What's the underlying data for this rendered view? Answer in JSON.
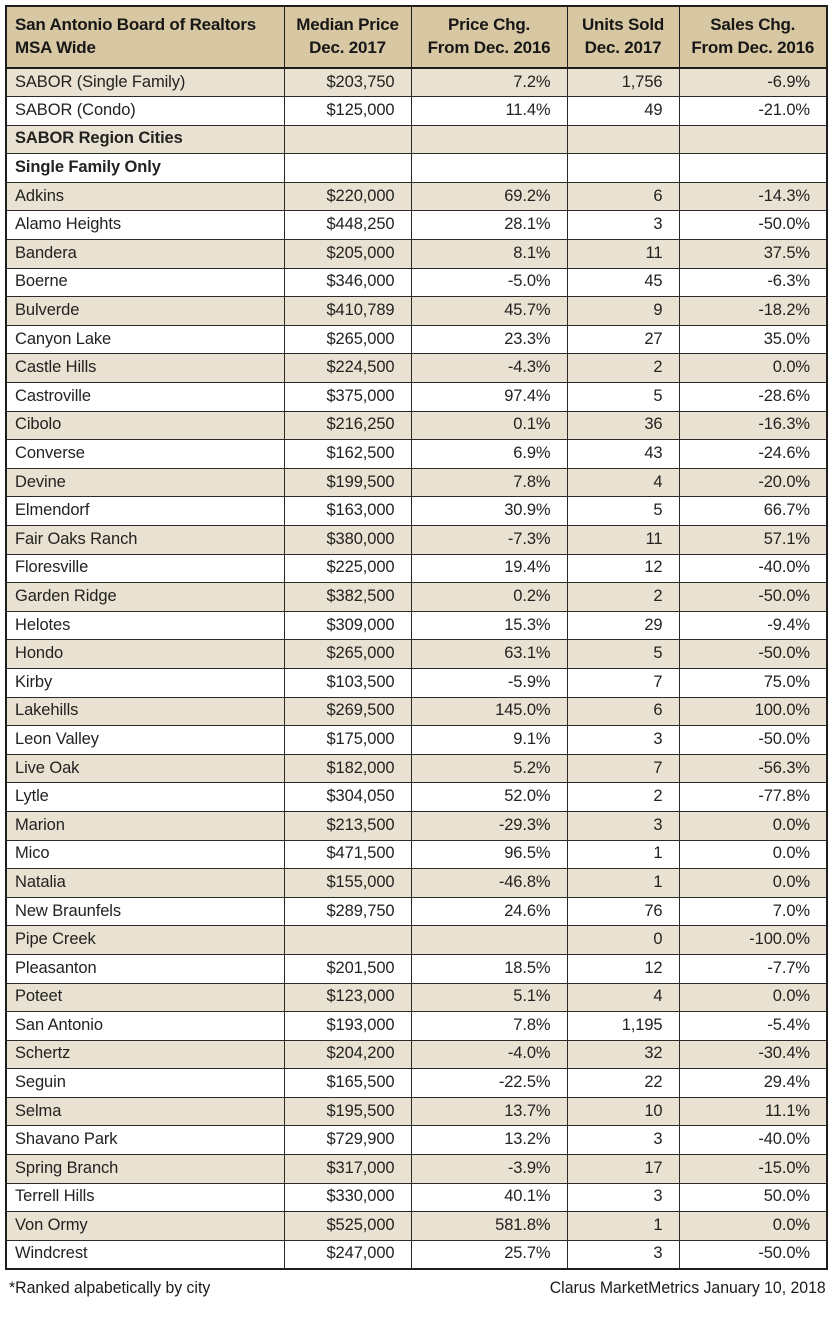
{
  "table": {
    "columns": [
      {
        "key": "city",
        "line1": "San Antonio Board of Realtors",
        "line2": "MSA Wide",
        "align": "left"
      },
      {
        "key": "price",
        "line1": "Median Price",
        "line2": "Dec. 2017",
        "align": "center"
      },
      {
        "key": "pchg",
        "line1": "Price Chg.",
        "line2": "From Dec. 2016",
        "align": "center"
      },
      {
        "key": "units",
        "line1": "Units Sold",
        "line2": "Dec. 2017",
        "align": "center"
      },
      {
        "key": "schg",
        "line1": "Sales Chg.",
        "line2": "From Dec. 2016",
        "align": "center"
      }
    ],
    "rows": [
      {
        "city": "SABOR (Single Family)",
        "price": "$203,750",
        "pchg": "7.2%",
        "units": "1,756",
        "schg": "-6.9%",
        "group": false
      },
      {
        "city": "SABOR (Condo)",
        "price": "$125,000",
        "pchg": "11.4%",
        "units": "49",
        "schg": "-21.0%",
        "group": false
      },
      {
        "city": "SABOR Region Cities",
        "price": "",
        "pchg": "",
        "units": "",
        "schg": "",
        "group": true
      },
      {
        "city": "Single Family Only",
        "price": "",
        "pchg": "",
        "units": "",
        "schg": "",
        "group": true
      },
      {
        "city": "Adkins",
        "price": "$220,000",
        "pchg": "69.2%",
        "units": "6",
        "schg": "-14.3%",
        "group": false
      },
      {
        "city": "Alamo Heights",
        "price": "$448,250",
        "pchg": "28.1%",
        "units": "3",
        "schg": "-50.0%",
        "group": false
      },
      {
        "city": "Bandera",
        "price": "$205,000",
        "pchg": "8.1%",
        "units": "11",
        "schg": "37.5%",
        "group": false
      },
      {
        "city": "Boerne",
        "price": "$346,000",
        "pchg": "-5.0%",
        "units": "45",
        "schg": "-6.3%",
        "group": false
      },
      {
        "city": "Bulverde",
        "price": "$410,789",
        "pchg": "45.7%",
        "units": "9",
        "schg": "-18.2%",
        "group": false
      },
      {
        "city": "Canyon Lake",
        "price": "$265,000",
        "pchg": "23.3%",
        "units": "27",
        "schg": "35.0%",
        "group": false
      },
      {
        "city": "Castle Hills",
        "price": "$224,500",
        "pchg": "-4.3%",
        "units": "2",
        "schg": "0.0%",
        "group": false
      },
      {
        "city": "Castroville",
        "price": "$375,000",
        "pchg": "97.4%",
        "units": "5",
        "schg": "-28.6%",
        "group": false
      },
      {
        "city": "Cibolo",
        "price": "$216,250",
        "pchg": "0.1%",
        "units": "36",
        "schg": "-16.3%",
        "group": false
      },
      {
        "city": "Converse",
        "price": "$162,500",
        "pchg": "6.9%",
        "units": "43",
        "schg": "-24.6%",
        "group": false
      },
      {
        "city": "Devine",
        "price": "$199,500",
        "pchg": "7.8%",
        "units": "4",
        "schg": "-20.0%",
        "group": false
      },
      {
        "city": "Elmendorf",
        "price": "$163,000",
        "pchg": "30.9%",
        "units": "5",
        "schg": "66.7%",
        "group": false
      },
      {
        "city": "Fair Oaks Ranch",
        "price": "$380,000",
        "pchg": "-7.3%",
        "units": "11",
        "schg": "57.1%",
        "group": false
      },
      {
        "city": "Floresville",
        "price": "$225,000",
        "pchg": "19.4%",
        "units": "12",
        "schg": "-40.0%",
        "group": false
      },
      {
        "city": "Garden Ridge",
        "price": "$382,500",
        "pchg": "0.2%",
        "units": "2",
        "schg": "-50.0%",
        "group": false
      },
      {
        "city": "Helotes",
        "price": "$309,000",
        "pchg": "15.3%",
        "units": "29",
        "schg": "-9.4%",
        "group": false
      },
      {
        "city": "Hondo",
        "price": "$265,000",
        "pchg": "63.1%",
        "units": "5",
        "schg": "-50.0%",
        "group": false
      },
      {
        "city": "Kirby",
        "price": "$103,500",
        "pchg": "-5.9%",
        "units": "7",
        "schg": "75.0%",
        "group": false
      },
      {
        "city": "Lakehills",
        "price": "$269,500",
        "pchg": "145.0%",
        "units": "6",
        "schg": "100.0%",
        "group": false
      },
      {
        "city": "Leon Valley",
        "price": "$175,000",
        "pchg": "9.1%",
        "units": "3",
        "schg": "-50.0%",
        "group": false
      },
      {
        "city": "Live Oak",
        "price": "$182,000",
        "pchg": "5.2%",
        "units": "7",
        "schg": "-56.3%",
        "group": false
      },
      {
        "city": "Lytle",
        "price": "$304,050",
        "pchg": "52.0%",
        "units": "2",
        "schg": "-77.8%",
        "group": false
      },
      {
        "city": "Marion",
        "price": "$213,500",
        "pchg": "-29.3%",
        "units": "3",
        "schg": "0.0%",
        "group": false
      },
      {
        "city": "Mico",
        "price": "$471,500",
        "pchg": "96.5%",
        "units": "1",
        "schg": "0.0%",
        "group": false
      },
      {
        "city": "Natalia",
        "price": "$155,000",
        "pchg": "-46.8%",
        "units": "1",
        "schg": "0.0%",
        "group": false
      },
      {
        "city": "New Braunfels",
        "price": "$289,750",
        "pchg": "24.6%",
        "units": "76",
        "schg": "7.0%",
        "group": false
      },
      {
        "city": "Pipe Creek",
        "price": "",
        "pchg": "",
        "units": "0",
        "schg": "-100.0%",
        "group": false
      },
      {
        "city": "Pleasanton",
        "price": "$201,500",
        "pchg": "18.5%",
        "units": "12",
        "schg": "-7.7%",
        "group": false
      },
      {
        "city": "Poteet",
        "price": "$123,000",
        "pchg": "5.1%",
        "units": "4",
        "schg": "0.0%",
        "group": false
      },
      {
        "city": "San Antonio",
        "price": "$193,000",
        "pchg": "7.8%",
        "units": "1,195",
        "schg": "-5.4%",
        "group": false
      },
      {
        "city": "Schertz",
        "price": "$204,200",
        "pchg": "-4.0%",
        "units": "32",
        "schg": "-30.4%",
        "group": false
      },
      {
        "city": "Seguin",
        "price": "$165,500",
        "pchg": "-22.5%",
        "units": "22",
        "schg": "29.4%",
        "group": false
      },
      {
        "city": "Selma",
        "price": "$195,500",
        "pchg": "13.7%",
        "units": "10",
        "schg": "11.1%",
        "group": false
      },
      {
        "city": "Shavano Park",
        "price": "$729,900",
        "pchg": "13.2%",
        "units": "3",
        "schg": "-40.0%",
        "group": false
      },
      {
        "city": "Spring Branch",
        "price": "$317,000",
        "pchg": "-3.9%",
        "units": "17",
        "schg": "-15.0%",
        "group": false
      },
      {
        "city": "Terrell Hills",
        "price": "$330,000",
        "pchg": "40.1%",
        "units": "3",
        "schg": "50.0%",
        "group": false
      },
      {
        "city": "Von Ormy",
        "price": "$525,000",
        "pchg": "581.8%",
        "units": "1",
        "schg": "0.0%",
        "group": false
      },
      {
        "city": "Windcrest",
        "price": "$247,000",
        "pchg": "25.7%",
        "units": "3",
        "schg": "-50.0%",
        "group": false
      }
    ]
  },
  "footer": {
    "note": "*Ranked alpabetically by city",
    "source": "Clarus MarketMetrics January 10, 2018"
  },
  "colors": {
    "header_background": "#d7c7a2",
    "row_shade": "#e9e2d2",
    "row_plain": "#ffffff",
    "border": "#1d1d1b",
    "text": "#222220"
  }
}
